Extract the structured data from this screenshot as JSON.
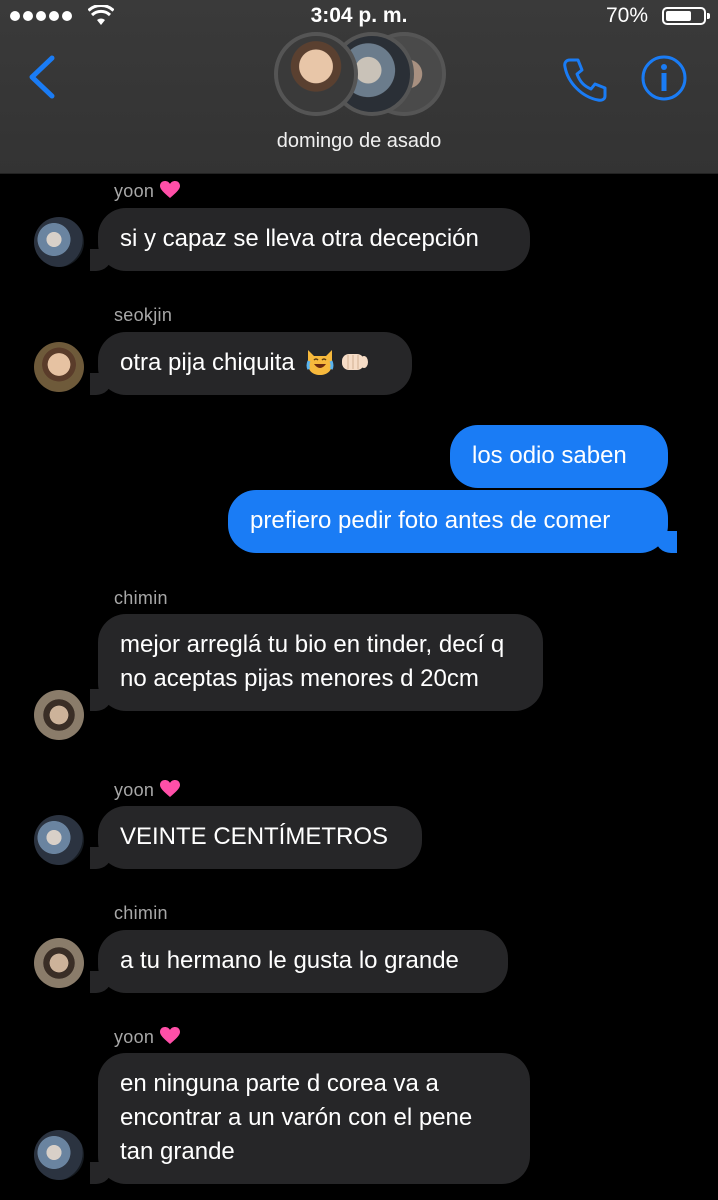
{
  "status_bar": {
    "time": "3:04 p. m.",
    "battery": "70%",
    "battery_level": 0.7
  },
  "header": {
    "group_name": "domingo de asado"
  },
  "icons": {
    "back": "chevron-left-icon",
    "call": "phone-icon",
    "info": "info-icon"
  },
  "colors": {
    "accent": "#1a7cf5",
    "incoming_bubble": "#262628",
    "header_bg": "#3a3a3a"
  },
  "messages": [
    {
      "sender": "yoon",
      "heart": true,
      "text": "si y capaz se lleva otra decepción"
    },
    {
      "sender": "seokjin",
      "heart": false,
      "text": "otra pija chiquita"
    },
    {
      "sender": "me",
      "text": "los odio saben"
    },
    {
      "sender": "me",
      "text": "prefiero pedir foto antes de comer"
    },
    {
      "sender": "chimin",
      "heart": false,
      "text": "mejor arreglá tu bio en tinder, decí q no aceptas pijas menores d 20cm"
    },
    {
      "sender": "yoon",
      "heart": true,
      "text": "VEINTE CENTÍMETROS"
    },
    {
      "sender": "chimin",
      "heart": false,
      "text": "a tu hermano le gusta lo grande"
    },
    {
      "sender": "yoon",
      "heart": true,
      "text": "en ninguna parte d corea va a encontrar a un varón con el pene tan grande"
    }
  ]
}
